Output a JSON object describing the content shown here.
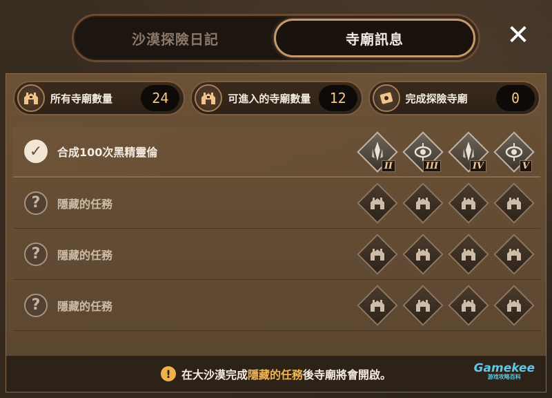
{
  "tabs": [
    {
      "label": "沙漠探險日記",
      "active": false
    },
    {
      "label": "寺廟訊息",
      "active": true
    }
  ],
  "close_icon": "close-icon",
  "stats": [
    {
      "icon": "temple-icon",
      "label": "所有寺廟數量",
      "value": "24"
    },
    {
      "icon": "temple-icon",
      "label": "可進入的寺廟數量",
      "value": "12"
    },
    {
      "icon": "scroll-map-icon",
      "label": "完成探險寺廟",
      "value": "0"
    }
  ],
  "tasks": [
    {
      "status": "done",
      "label": "合成100次黑精靈倫",
      "temples": [
        {
          "icon": "temple-emblem-blade-icon",
          "numeral": "II"
        },
        {
          "icon": "temple-emblem-eye-icon",
          "numeral": "III"
        },
        {
          "icon": "temple-emblem-blade-icon",
          "numeral": "IV"
        },
        {
          "icon": "temple-emblem-eye-icon",
          "numeral": "V"
        }
      ]
    },
    {
      "status": "hidden",
      "label": "隱藏的任務",
      "temples": [
        {
          "icon": "locked-temple-icon"
        },
        {
          "icon": "locked-temple-icon"
        },
        {
          "icon": "locked-temple-icon"
        },
        {
          "icon": "locked-temple-icon"
        }
      ]
    },
    {
      "status": "hidden",
      "label": "隱藏的任務",
      "temples": [
        {
          "icon": "locked-temple-icon"
        },
        {
          "icon": "locked-temple-icon"
        },
        {
          "icon": "locked-temple-icon"
        },
        {
          "icon": "locked-temple-icon"
        }
      ]
    },
    {
      "status": "hidden",
      "label": "隱藏的任務",
      "temples": [
        {
          "icon": "locked-temple-icon"
        },
        {
          "icon": "locked-temple-icon"
        },
        {
          "icon": "locked-temple-icon"
        },
        {
          "icon": "locked-temple-icon"
        }
      ]
    }
  ],
  "footer": {
    "prefix": "在大沙漠完成",
    "highlight": "隱藏的任務",
    "suffix": "後寺廟將會開啟。",
    "icon": "warning-icon"
  },
  "logo": {
    "name": "Gamekee",
    "tagline": "游戏攻略百科"
  },
  "colors": {
    "accent": "#f2b552",
    "value_text": "#f2c88e",
    "tab_active_border": "#c49a6c"
  }
}
